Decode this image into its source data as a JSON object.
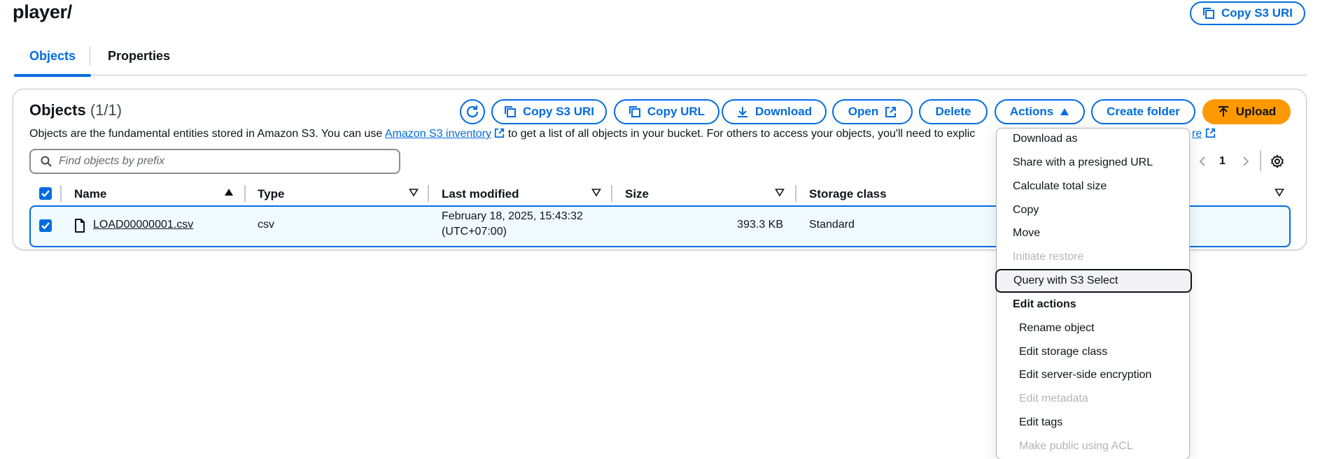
{
  "header": {
    "title": "player/",
    "copy_s3_uri_label": "Copy S3 URI"
  },
  "tabs": [
    {
      "label": "Objects",
      "active": true
    },
    {
      "label": "Properties",
      "active": false
    }
  ],
  "objects": {
    "title": "Objects",
    "count": "(1/1)",
    "description_prefix": "Objects are the fundamental entities stored in Amazon S3. You can use ",
    "inventory_link": "Amazon S3 inventory",
    "description_middle": " to get a list of all objects in your bucket. For others to access your objects, you'll need to explic",
    "description_tail_link": "re",
    "search_placeholder": "Find objects by prefix",
    "page_number": "1"
  },
  "toolbar": {
    "copy_s3_uri": "Copy S3 URI",
    "copy_url": "Copy URL",
    "download": "Download",
    "open": "Open",
    "delete": "Delete",
    "actions": "Actions",
    "create_folder": "Create folder",
    "upload": "Upload"
  },
  "table": {
    "columns": [
      "Name",
      "Type",
      "Last modified",
      "Size",
      "Storage class"
    ],
    "rows": [
      {
        "name": "LOAD00000001.csv",
        "type": "csv",
        "last_modified_line1": "February 18, 2025, 15:43:32",
        "last_modified_line2": "(UTC+07:00)",
        "size": "393.3 KB",
        "storage_class": "Standard",
        "selected": true
      }
    ]
  },
  "actions_menu": {
    "items": [
      {
        "label": "Download as",
        "disabled": false
      },
      {
        "label": "Share with a presigned URL",
        "disabled": false
      },
      {
        "label": "Calculate total size",
        "disabled": false
      },
      {
        "label": "Copy",
        "disabled": false
      },
      {
        "label": "Move",
        "disabled": false
      },
      {
        "label": "Initiate restore",
        "disabled": true
      },
      {
        "label": "Query with S3 Select",
        "disabled": false,
        "focused": true
      }
    ],
    "group_heading": "Edit actions",
    "sub_items": [
      {
        "label": "Rename object",
        "disabled": false
      },
      {
        "label": "Edit storage class",
        "disabled": false
      },
      {
        "label": "Edit server-side encryption",
        "disabled": false
      },
      {
        "label": "Edit metadata",
        "disabled": true
      },
      {
        "label": "Edit tags",
        "disabled": false
      },
      {
        "label": "Make public using ACL",
        "disabled": true
      }
    ]
  },
  "colors": {
    "accent": "#006ce0",
    "upload": "#ff9900",
    "text": "#0f141a",
    "disabled": "#b4b4bb"
  }
}
